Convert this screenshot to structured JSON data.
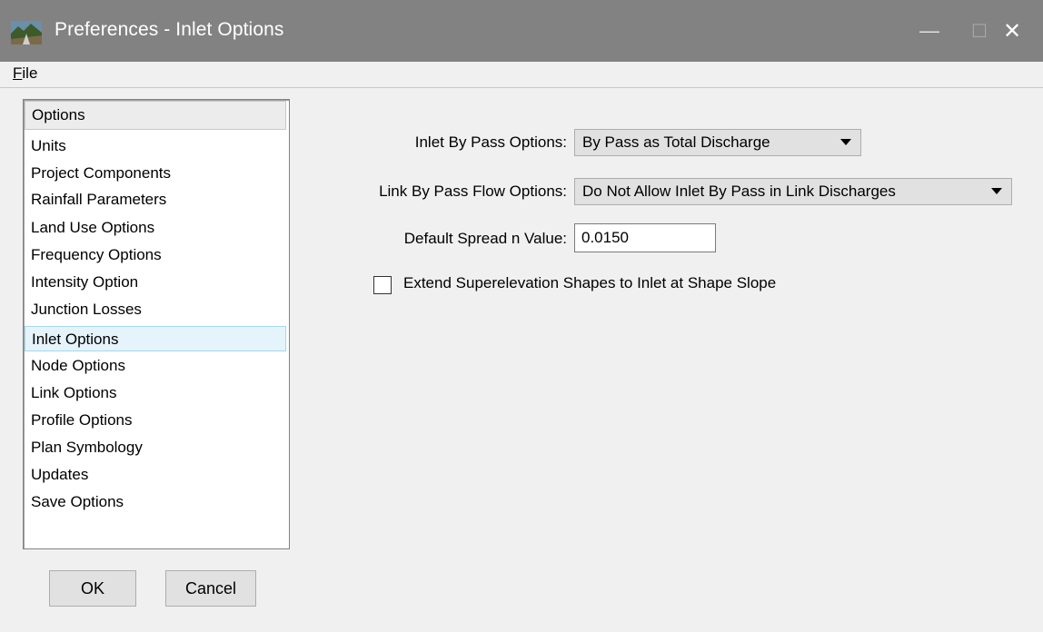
{
  "window": {
    "title": "Preferences - Inlet Options",
    "icon": "app-landscape-icon",
    "controls": {
      "minimize": "—",
      "maximize": "☐",
      "close": "✕"
    }
  },
  "menu": {
    "file_mnemonic": "F",
    "file_rest": "ile"
  },
  "options_list": {
    "header": "Options",
    "items": [
      "Units",
      "Project Components",
      "Rainfall Parameters",
      "Land Use Options",
      "Frequency Options",
      "Intensity Option",
      "Junction Losses",
      "Inlet Options",
      "Node Options",
      "Link Options",
      "Profile Options",
      "Plan Symbology",
      "Updates",
      "Save Options"
    ],
    "selected": "Inlet Options"
  },
  "buttons": {
    "ok": "OK",
    "cancel": "Cancel"
  },
  "settings": {
    "inlet_bypass_label": "Inlet By Pass Options:",
    "inlet_bypass_value": "By Pass as Total Discharge",
    "link_bypass_label": "Link By Pass Flow Options:",
    "link_bypass_value": "Do Not Allow Inlet By Pass in Link Discharges",
    "spread_label": "Default Spread n Value:",
    "spread_value": "0.0150",
    "extend_checkbox_label": "Extend Superelevation Shapes to Inlet at Shape Slope",
    "extend_checked": false
  }
}
